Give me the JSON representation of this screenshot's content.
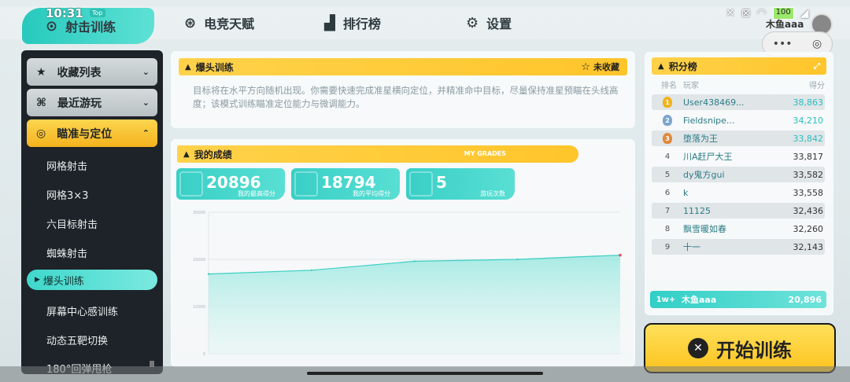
{
  "status": {
    "time": "10:31",
    "badge": "Top",
    "battery": "100"
  },
  "nav": [
    {
      "label": "射击训练",
      "icon": "target"
    },
    {
      "label": "电竞天赋",
      "icon": "talent"
    },
    {
      "label": "排行榜",
      "icon": "podium"
    },
    {
      "label": "设置",
      "icon": "gear"
    }
  ],
  "user_corner": {
    "name": "木鱼aaa"
  },
  "capsule": {
    "more": "•••",
    "close": "◎"
  },
  "sidebar": {
    "categories": [
      {
        "label": "收藏列表",
        "chevron": "⌄"
      },
      {
        "label": "最近游玩",
        "chevron": "⌄"
      },
      {
        "label": "瞄准与定位",
        "chevron": "⌃"
      }
    ],
    "items": [
      "网格射击",
      "网格3×3",
      "六目标射击",
      "蜘蛛射击",
      "爆头训练",
      "屏幕中心感训练",
      "动态五靶切换",
      "180°回弹甩枪"
    ],
    "active_index": 4
  },
  "mode": {
    "title": "爆头训练",
    "favorite_label": "未收藏",
    "description": "目标将在水平方向随机出现。你需要快速完成准星横向定位，并精准命中目标，尽量保持准星预瞄在头线高度；该模式训练瞄准定位能力与微调能力。"
  },
  "grades": {
    "title": "我的成绩",
    "tag": "MY GRADES",
    "cards": [
      {
        "value": "20896",
        "label": "我的最高得分"
      },
      {
        "value": "18794",
        "label": "我的平均得分"
      },
      {
        "value": "5",
        "label": "游玩次数"
      }
    ]
  },
  "chart_data": {
    "type": "area",
    "title": "",
    "xlabel": "",
    "ylabel": "",
    "x": [
      1,
      2,
      3,
      4,
      5
    ],
    "values": [
      16900,
      17700,
      19600,
      20000,
      20896
    ],
    "ylim": [
      0,
      30000
    ],
    "yticks": [
      "30000",
      "20000",
      "10000",
      "0"
    ],
    "grid": true,
    "color": "#3ccfc4"
  },
  "leaderboard": {
    "title": "积分榜",
    "headers": {
      "rank": "排名",
      "player": "玩家",
      "score": "得分"
    },
    "rows": [
      {
        "rank": "1",
        "name": "User438469...",
        "score": "38,863"
      },
      {
        "rank": "2",
        "name": "Fieldsnipe...",
        "score": "34,210"
      },
      {
        "rank": "3",
        "name": "堕落为王",
        "score": "33,842"
      },
      {
        "rank": "4",
        "name": "川A赶尸大王",
        "score": "33,817"
      },
      {
        "rank": "5",
        "name": "dy鬼方gui",
        "score": "33,582"
      },
      {
        "rank": "6",
        "name": "k",
        "score": "33,558"
      },
      {
        "rank": "7",
        "name": "11125",
        "score": "32,436"
      },
      {
        "rank": "8",
        "name": "飘雪暖如春",
        "score": "32,260"
      },
      {
        "rank": "9",
        "name": "十一",
        "score": "32,143"
      }
    ],
    "me": {
      "rank": "1w+",
      "name": "木鱼aaa",
      "score": "20,896"
    }
  },
  "start_button": {
    "label": "开始训练"
  },
  "colors": {
    "accent": "#3ccfc4",
    "yellow": "#ffc52b",
    "dark": "#1d2328"
  }
}
